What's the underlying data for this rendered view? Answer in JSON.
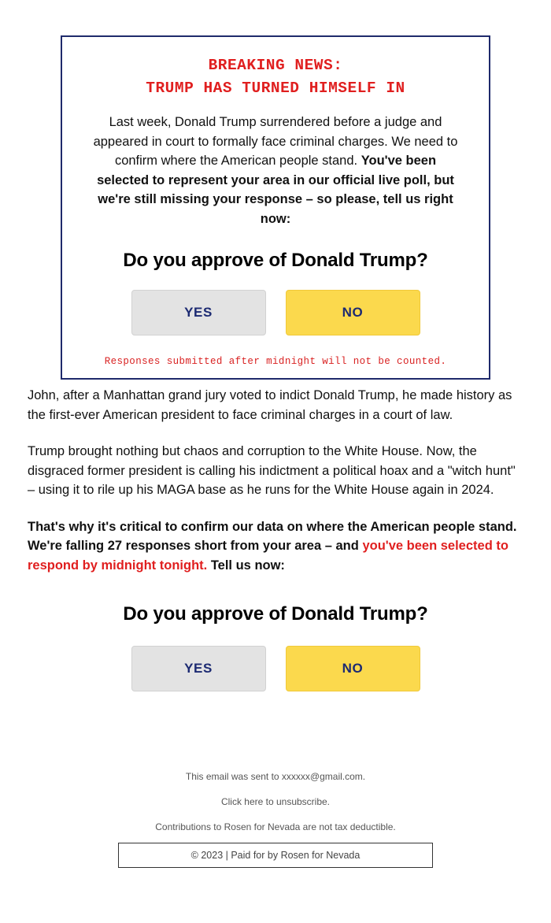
{
  "alert": {
    "headline_line1": "BREAKING NEWS:",
    "headline_line2": "TRUMP HAS TURNED HIMSELF IN",
    "body_plain_1": "Last week, Donald Trump surrendered before a judge and appeared in court to formally face criminal charges. We need to confirm where the American people stand. ",
    "body_bold_1": "You've been selected to represent your area in our official live poll, but we're still missing your response – so please, tell us right now:",
    "question": "Do you approve of Donald Trump?",
    "yes_label": "YES",
    "no_label": "NO",
    "footnote": "Responses submitted after midnight will not be counted.",
    "border_color": "#1f2a6b",
    "headline_color": "#e01f1f",
    "footnote_color": "#d92222"
  },
  "body": {
    "paragraph_1": "John, after a Manhattan grand jury voted to indict Donald Trump, he made history as the first-ever American president to face criminal charges in a court of law.",
    "paragraph_2": "Trump brought nothing but chaos and corruption to the White House. Now, the disgraced former president is calling his indictment a political hoax and a \"witch hunt\" – using it to rile up his MAGA base as he runs for the White House again in 2024.",
    "paragraph_3_part1": "That's why it's critical to confirm our data on where the American people stand. We're falling 27 responses short from your area – and ",
    "paragraph_3_red": "you've been selected to respond by midnight tonight.",
    "paragraph_3_part2": " Tell us now:",
    "responses_short_count": "27"
  },
  "poll2": {
    "question": "Do you approve of Donald Trump?",
    "yes_label": "YES",
    "no_label": "NO"
  },
  "footer": {
    "sent_to": "This email was sent to xxxxxx@gmail.com.",
    "unsubscribe": "Click here to unsubscribe.",
    "tax_notice": "Contributions to Rosen for Nevada are not tax deductible.",
    "copyright": "© 2023 | Paid for by Rosen for Nevada"
  },
  "colors": {
    "navy_border": "#1f2a6b",
    "red": "#e01f1f",
    "button_yellow": "#fbd94d",
    "button_gray": "#e3e3e3",
    "button_text_navy": "#1c2a72"
  }
}
